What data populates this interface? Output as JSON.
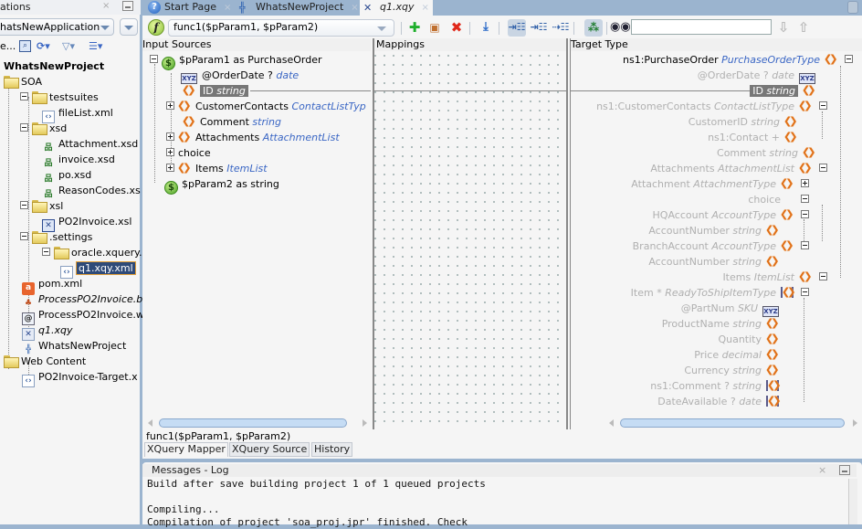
{
  "left_panel": {
    "title": "ations",
    "app_selector": "hatsNewApplication",
    "toolbar_prefix": "e...",
    "tree": [
      {
        "label": "WhatsNewProject",
        "kind": "project-root"
      },
      {
        "label": "SOA",
        "kind": "folder"
      },
      {
        "label": "testsuites",
        "kind": "folder"
      },
      {
        "label": "fileList.xml",
        "kind": "xml"
      },
      {
        "label": "xsd",
        "kind": "folder"
      },
      {
        "label": "Attachment.xsd",
        "kind": "xsd"
      },
      {
        "label": "invoice.xsd",
        "kind": "xsd"
      },
      {
        "label": "po.xsd",
        "kind": "xsd"
      },
      {
        "label": "ReasonCodes.xs",
        "kind": "xsd"
      },
      {
        "label": "xsl",
        "kind": "folder"
      },
      {
        "label": "PO2Invoice.xsl",
        "kind": "xsl"
      },
      {
        "label": ".settings",
        "kind": "folder"
      },
      {
        "label": "oracle.xquery.ma",
        "kind": "folder"
      },
      {
        "label": "q1.xqy.xml",
        "kind": "xml",
        "selected": true
      },
      {
        "label": "pom.xml",
        "kind": "pom"
      },
      {
        "label": "ProcessPO2Invoice.b",
        "kind": "bpel"
      },
      {
        "label": "ProcessPO2Invoice.w",
        "kind": "wsdl"
      },
      {
        "label": "q1.xqy",
        "kind": "xqy"
      },
      {
        "label": "WhatsNewProject",
        "kind": "project"
      },
      {
        "label": "Web Content",
        "kind": "folder"
      },
      {
        "label": "PO2Invoice-Target.x",
        "kind": "xml"
      }
    ]
  },
  "editor": {
    "tabs": [
      {
        "label": "Start Page",
        "icon": "help-icon"
      },
      {
        "label": "WhatsNewProject",
        "icon": "project-icon"
      },
      {
        "label": "q1.xqy",
        "icon": "xquery-file-icon",
        "active": true
      }
    ],
    "function_selector": "func1($pParam1, $pParam2)",
    "search_value": "",
    "panes": {
      "input_title": "Input Sources",
      "mappings_title": "Mappings",
      "target_title": "Target Type"
    },
    "input_tree": [
      {
        "name": "$pParam1 as PurchaseOrder",
        "type": "",
        "icon": "param"
      },
      {
        "name": "@OrderDate ?",
        "type": "date",
        "icon": "attribute"
      },
      {
        "name": "ID",
        "type": "string",
        "icon": "element",
        "highlighted": true
      },
      {
        "name": "CustomerContacts",
        "type": "ContactListTyp",
        "icon": "element"
      },
      {
        "name": "Comment",
        "type": "string",
        "icon": "element"
      },
      {
        "name": "Attachments",
        "type": "AttachmentList",
        "icon": "element"
      },
      {
        "name": "choice",
        "type": "",
        "icon": "none"
      },
      {
        "name": "Items",
        "type": "ItemList",
        "icon": "element"
      },
      {
        "name": "$pParam2 as string",
        "type": "",
        "icon": "param"
      }
    ],
    "target_tree": [
      {
        "name": "ns1:PurchaseOrder",
        "type": "PurchaseOrderType",
        "active": true
      },
      {
        "name": "@OrderDate ?",
        "type": "date"
      },
      {
        "name": "ID",
        "type": "string",
        "highlighted": true
      },
      {
        "name": "ns1:CustomerContacts",
        "type": "ContactListType"
      },
      {
        "name": "CustomerID",
        "type": "string"
      },
      {
        "name": "ns1:Contact +",
        "type": ""
      },
      {
        "name": "Comment",
        "type": "string"
      },
      {
        "name": "Attachments",
        "type": "AttachmentList"
      },
      {
        "name": "Attachment",
        "type": "AttachmentType"
      },
      {
        "name": "choice",
        "type": ""
      },
      {
        "name": "HQAccount",
        "type": "AccountType"
      },
      {
        "name": "AccountNumber",
        "type": "string"
      },
      {
        "name": "BranchAccount",
        "type": "AccountType"
      },
      {
        "name": "AccountNumber",
        "type": "string"
      },
      {
        "name": "Items",
        "type": "ItemList"
      },
      {
        "name": "Item *",
        "type": "ReadyToShipItemType"
      },
      {
        "name": "@PartNum",
        "type": "SKU"
      },
      {
        "name": "ProductName",
        "type": "string"
      },
      {
        "name": "Quantity",
        "type": ""
      },
      {
        "name": "Price",
        "type": "decimal"
      },
      {
        "name": "Currency",
        "type": "string"
      },
      {
        "name": "ns1:Comment ?",
        "type": "string"
      },
      {
        "name": "DateAvailable ?",
        "type": "date"
      }
    ],
    "function_signature": "func1($pParam1, $pParam2)",
    "bottom_tabs": [
      "XQuery Mapper",
      "XQuery Source",
      "History"
    ]
  },
  "log": {
    "title": "Messages - Log",
    "lines": [
      "Build after save building project 1 of 1 queued projects",
      "",
      "Compiling...",
      "Compilation of project 'soa_proj.jpr' finished. Check"
    ]
  }
}
